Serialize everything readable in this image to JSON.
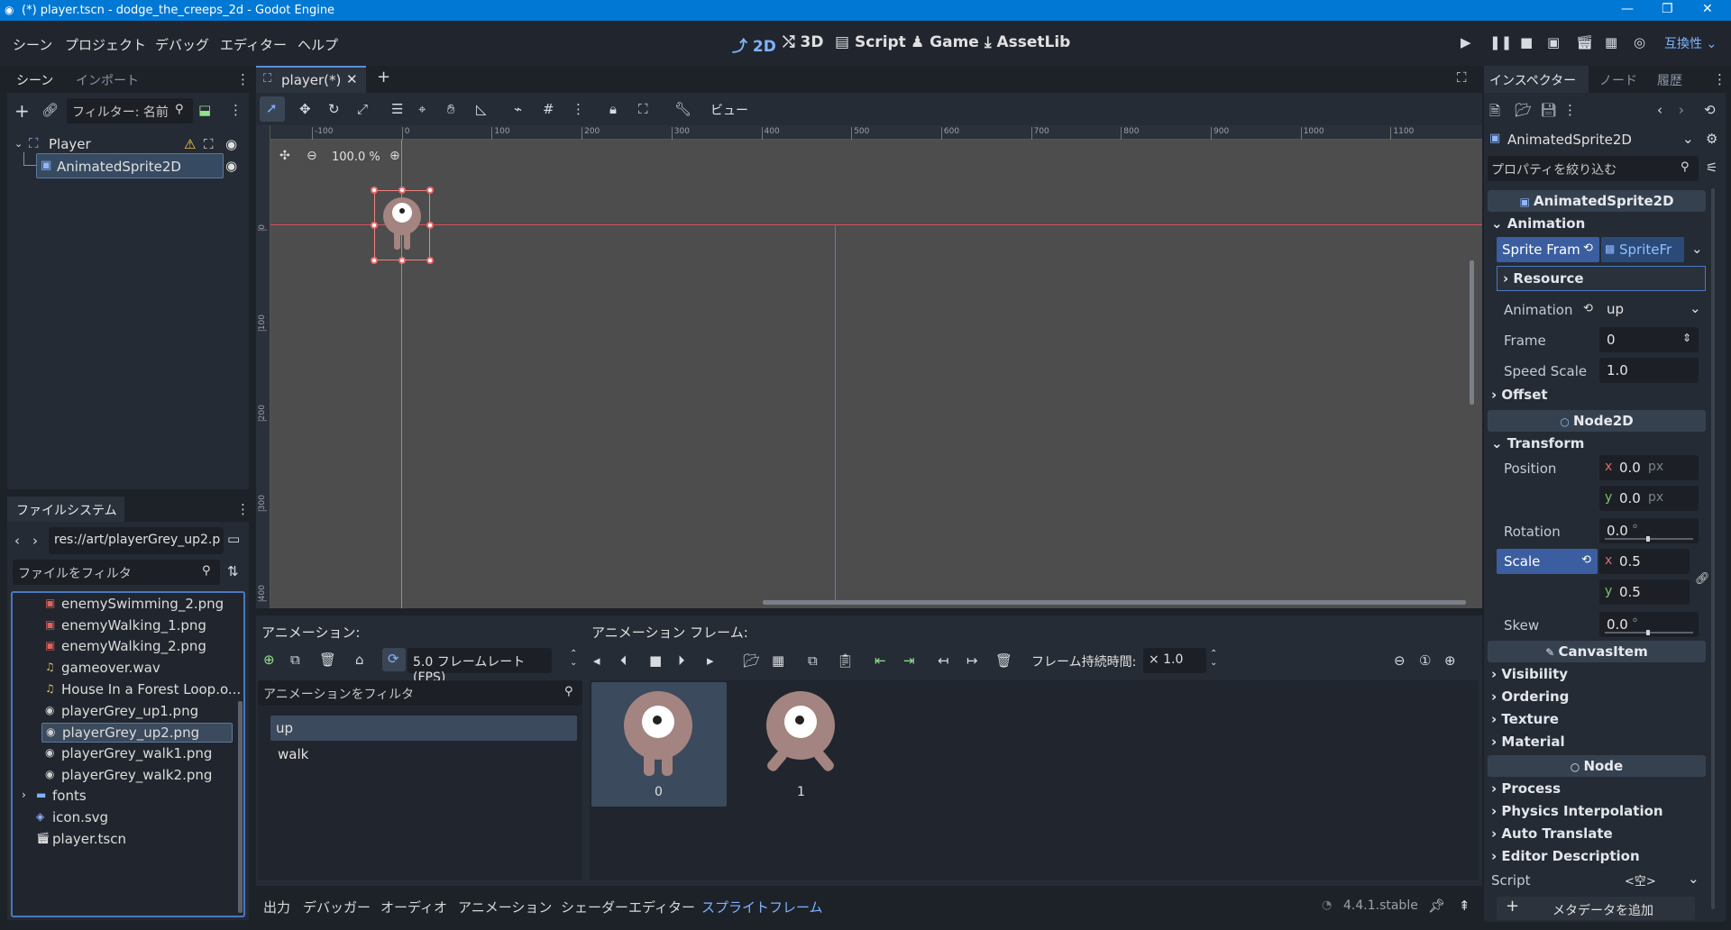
{
  "window": {
    "title": "(*) player.tscn - dodge_the_creeps_2d - Godot Engine"
  },
  "menu": [
    "シーン",
    "プロジェクト",
    "デバッグ",
    "エディター",
    "ヘルプ"
  ],
  "workspaces": {
    "w2d": "2D",
    "w3d": "3D",
    "script": "Script",
    "game": "Game",
    "assetlib": "AssetLib"
  },
  "compat": "互換性",
  "scene_dock": {
    "tab_scene": "シーン",
    "tab_import": "インポート",
    "filter_placeholder": "フィルター: 名前",
    "root": "Player",
    "child": "AnimatedSprite2D"
  },
  "filesystem": {
    "tab": "ファイルシステム",
    "path": "res://art/playerGrey_up2.p",
    "filter_placeholder": "ファイルをフィルタ",
    "files": [
      {
        "name": "enemySwimming_2.png",
        "icon": "image-red"
      },
      {
        "name": "enemyWalking_1.png",
        "icon": "image-red"
      },
      {
        "name": "enemyWalking_2.png",
        "icon": "image-red"
      },
      {
        "name": "gameover.wav",
        "icon": "audio"
      },
      {
        "name": "House In a Forest Loop.o...",
        "icon": "audio"
      },
      {
        "name": "playerGrey_up1.png",
        "icon": "image-grey"
      },
      {
        "name": "playerGrey_up2.png",
        "icon": "image-grey",
        "selected": true
      },
      {
        "name": "playerGrey_walk1.png",
        "icon": "image-grey"
      },
      {
        "name": "playerGrey_walk2.png",
        "icon": "image-grey"
      },
      {
        "name": "fonts",
        "icon": "folder"
      },
      {
        "name": "icon.svg",
        "icon": "svg"
      },
      {
        "name": "player.tscn",
        "icon": "scene"
      }
    ]
  },
  "editor": {
    "tab": "player(*)",
    "view": "ビュー",
    "zoom": "100.0 %",
    "ruler_top": [
      "-100",
      "0",
      "100",
      "200",
      "300",
      "400",
      "500",
      "600",
      "700",
      "800",
      "900",
      "1000",
      "1100"
    ],
    "ruler_left": [
      "0",
      "100",
      "200",
      "300",
      "400"
    ]
  },
  "anim_panel": {
    "anim_label": "アニメーション:",
    "frames_label": "アニメーション フレーム:",
    "fps": "5.0 フレームレート(FPS)",
    "duration_label": "フレーム持続時間:",
    "duration": "× 1.0",
    "filter_placeholder": "アニメーションをフィルタ",
    "animations": [
      "up",
      "walk"
    ],
    "frames": [
      "0",
      "1"
    ]
  },
  "bottom_tabs": [
    "出力",
    "デバッガー",
    "オーディオ",
    "アニメーション",
    "シェーダーエディター",
    "スプライトフレーム"
  ],
  "version": "4.4.1.stable",
  "inspector": {
    "tab_inspector": "インスペクター",
    "tab_node": "ノード",
    "tab_history": "履歴",
    "object": "AnimatedSprite2D",
    "filter_placeholder": "プロパティを絞り込む",
    "cat_sprite": "AnimatedSprite2D",
    "sec_animation": "Animation",
    "sprite_frames_label": "Sprite Fram",
    "sprite_frames_value": "SpriteFr",
    "resource": "Resource",
    "animation_label": "Animation",
    "animation_value": "up",
    "frame_label": "Frame",
    "frame_value": "0",
    "speed_label": "Speed Scale",
    "speed_value": "1.0",
    "offset": "Offset",
    "cat_node2d": "Node2D",
    "transform": "Transform",
    "position_label": "Position",
    "pos_x": "0.0",
    "pos_y": "0.0",
    "px": "px",
    "rotation_label": "Rotation",
    "rotation_value": "0.0",
    "scale_label": "Scale",
    "scale_x": "0.5",
    "scale_y": "0.5",
    "skew_label": "Skew",
    "skew_value": "0.0",
    "deg": "°",
    "cat_canvas": "CanvasItem",
    "canvas_sections": [
      "Visibility",
      "Ordering",
      "Texture",
      "Material"
    ],
    "cat_node": "Node",
    "node_sections": [
      "Process",
      "Physics Interpolation",
      "Auto Translate",
      "Editor Description"
    ],
    "script_label": "Script",
    "script_value": "<空>",
    "add_meta": "メタデータを追加"
  }
}
